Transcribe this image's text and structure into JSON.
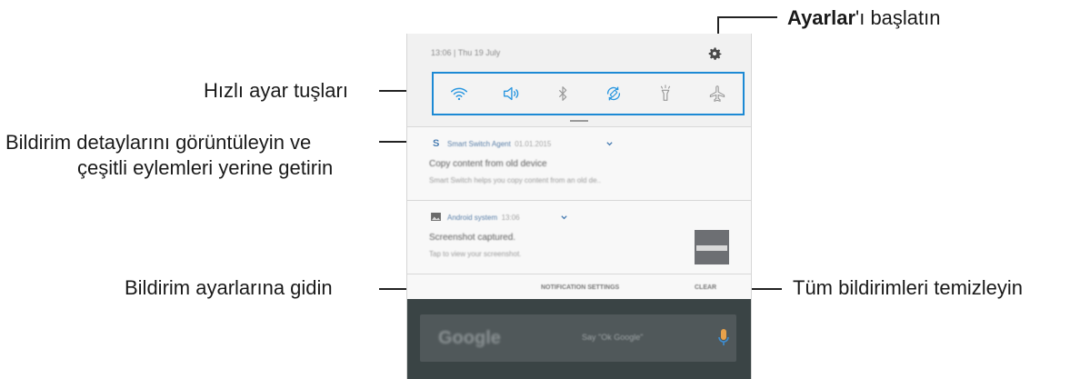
{
  "callouts": {
    "settings_bold": "Ayarlar",
    "settings_rest": "'ı başlatın",
    "quick_settings": "Hızlı ayar tuşları",
    "notif_details_line1": "Bildirim detaylarını görüntüleyin ve",
    "notif_details_line2": "çeşitli eylemleri yerine getirin",
    "notif_settings": "Bildirim ayarlarına gidin",
    "clear_all": "Tüm bildirimleri temizleyin"
  },
  "panel": {
    "status_date": "13:06 | Thu 19 July",
    "quick_icons": [
      "wifi-icon",
      "sound-icon",
      "bluetooth-icon",
      "auto-rotate-icon",
      "flashlight-icon",
      "airplane-mode-icon"
    ],
    "notifications": [
      {
        "app": "Smart Switch Agent",
        "time": "01.01.2015",
        "title": "Copy content from old device",
        "body": "Smart Switch helps you copy content from an old de.."
      },
      {
        "app": "Android system",
        "time": "13:06",
        "title": "Screenshot captured.",
        "body": "Tap to view your screenshot."
      }
    ],
    "notification_settings_label": "NOTIFICATION SETTINGS",
    "clear_label": "CLEAR",
    "search_brand": "Google",
    "search_hint": "Say \"Ok Google\""
  },
  "colors": {
    "accent": "#1c89d4",
    "panel_bg": "#f1f1f1",
    "bottom_bg": "#3a4445"
  }
}
